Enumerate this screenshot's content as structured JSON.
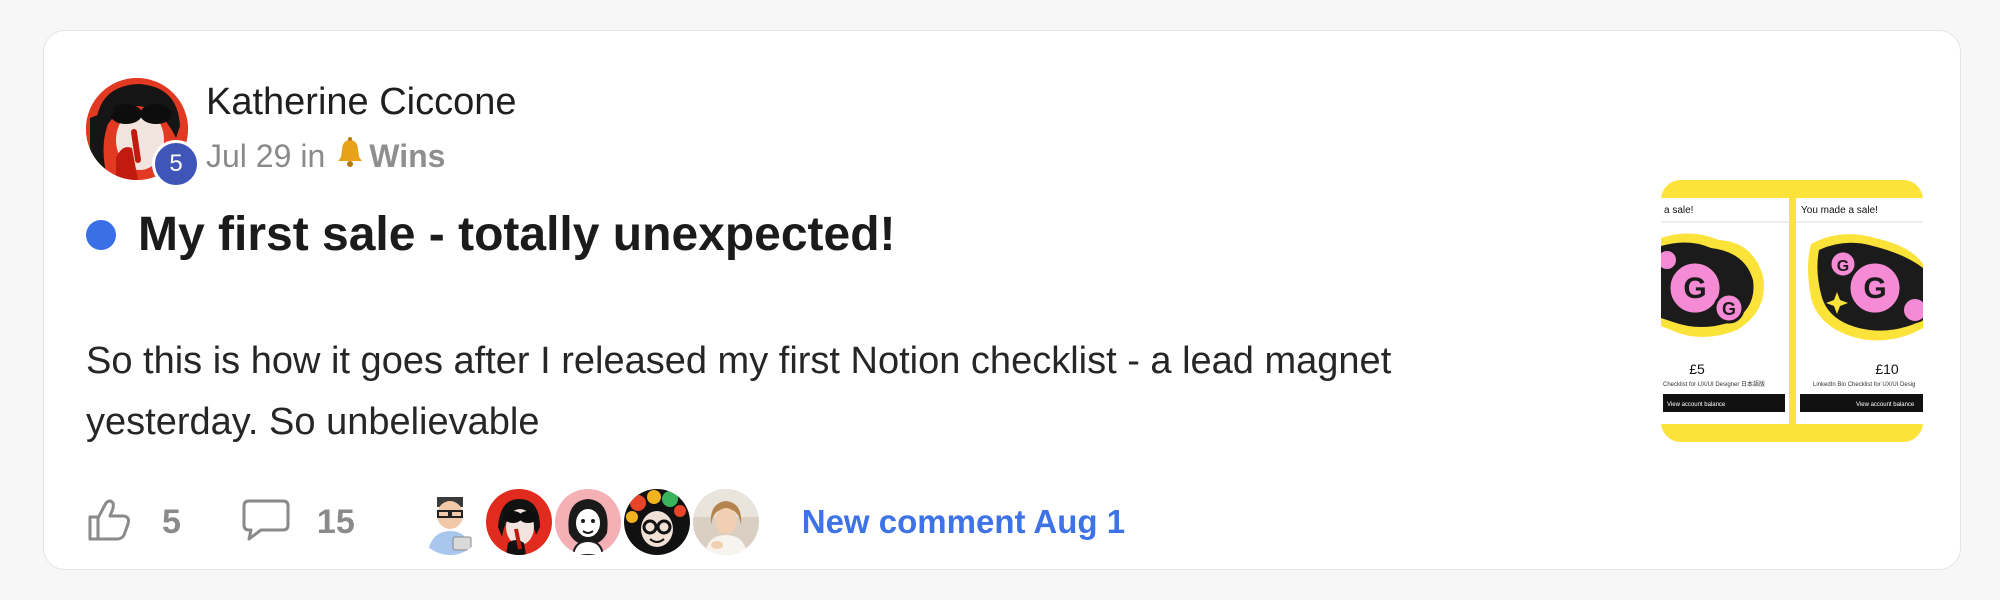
{
  "post": {
    "author": "Katherine Ciccone",
    "level": "5",
    "date": "Jul 29",
    "in_label": "in",
    "space_icon": "bell-icon",
    "space": "Wins",
    "title": "My first sale - totally unexpected!",
    "body": "So this is how it goes after I released my first Notion checklist - a lead magnet yesterday. So unbelievable",
    "unread": true
  },
  "thumbnail": {
    "panel_left": {
      "header": "a sale!",
      "price": "£5",
      "product": "Checklist for UX/UI Designer 日本語版",
      "button": "View account balance"
    },
    "panel_right": {
      "header": "You made a sale!",
      "price": "£10",
      "product": "LinkedIn Bio Checklist for UX/UI Desig",
      "button": "View account balance"
    }
  },
  "footer": {
    "likes": "5",
    "comments": "15",
    "participants": [
      "avatar-glasses-man",
      "avatar-red-sunglasses",
      "avatar-pink-illustration",
      "avatar-flower-crown",
      "avatar-woman-photo"
    ],
    "new_comment": "New comment Aug 1"
  },
  "colors": {
    "accent": "#3d73e6",
    "unread_dot": "#3b6fe8",
    "level_badge": "#3f55b8",
    "thumbnail_bg": "#fbe33a"
  }
}
